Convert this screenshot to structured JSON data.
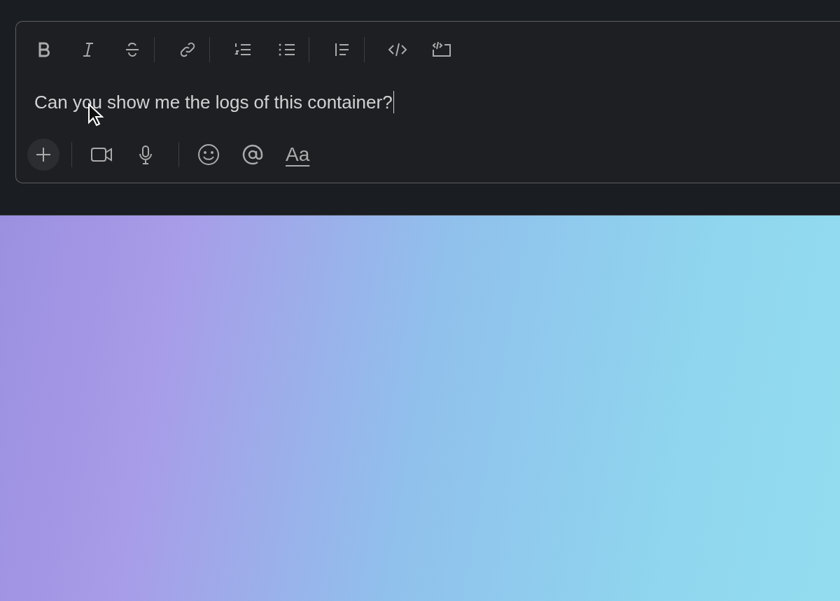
{
  "composer": {
    "message": "Can you show me the logs of this container?",
    "format_button": "Aa"
  }
}
